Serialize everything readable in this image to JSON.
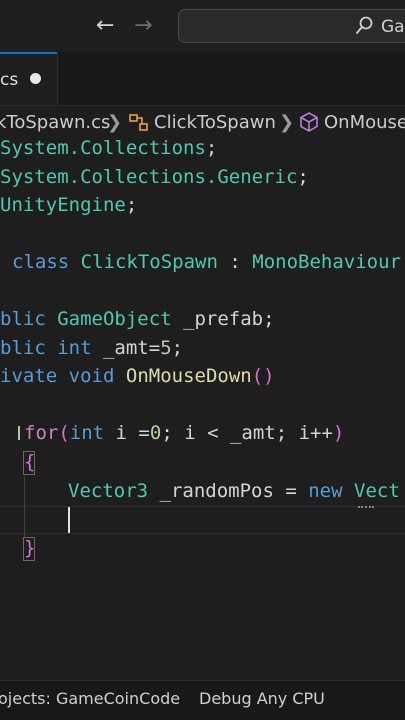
{
  "titlebar": {
    "search_text": "Ga"
  },
  "tabs": [
    {
      "label": "cs"
    }
  ],
  "breadcrumb": {
    "file": "kToSpawn.cs",
    "class": "ClickToSpawn",
    "member": "OnMouse"
  },
  "code": {
    "l1": {
      "a": "System.Collections",
      "b": ";"
    },
    "l2": {
      "a": "System.Collections.Generic",
      "b": ";"
    },
    "l3": {
      "a": "UnityEngine",
      "b": ";"
    },
    "l5": {
      "kw": "class",
      "cls": "ClickToSpawn",
      "colon": " : ",
      "base": "MonoBehaviour"
    },
    "l7": {
      "kw": "blic",
      "typ": "GameObject",
      "rest": " _prefab;"
    },
    "l8": {
      "kw": "blic",
      "typ": "int",
      "rest": " _amt=",
      "num": "5",
      "end": ";"
    },
    "l9": {
      "kw": "ivate",
      "typ": "void",
      "fn": "OnMouseDown",
      "paren": "()"
    },
    "l11": {
      "ctl": "for",
      "p1": "(",
      "typ": "int",
      "rest1": " i =",
      "n0": "0",
      "rest2": "; i < _amt; i++",
      "p2": ")"
    },
    "l12": {
      "brace": "{"
    },
    "l13": {
      "typ": "Vector3",
      "mid": " _randomPos = ",
      "kw": "new",
      "typ2": " Vect"
    },
    "l16": {
      "brace": "}"
    }
  },
  "status": {
    "projects": "ojects: GameCoinCode",
    "config": "Debug Any CPU"
  }
}
